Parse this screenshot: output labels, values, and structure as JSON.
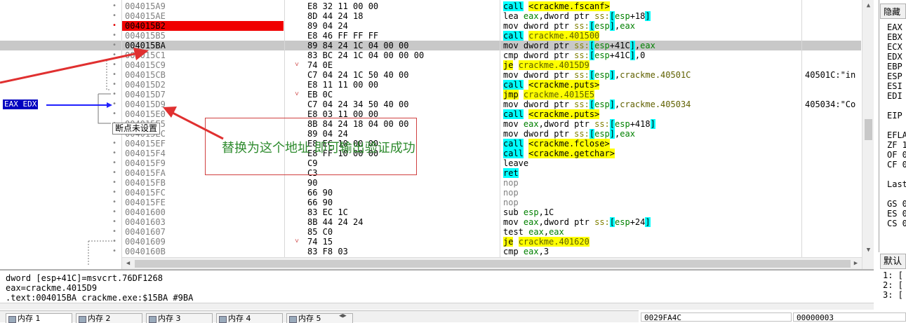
{
  "disasm": {
    "rows": [
      {
        "addr": "004015A9",
        "bytes": "E8 32 11 00 00",
        "instr": "call <crackme.fscanf>",
        "cmt": ""
      },
      {
        "addr": "004015AE",
        "bytes": "8D 44 24 18",
        "instr": "lea eax,dword ptr ss:[esp+18]",
        "cmt": ""
      },
      {
        "addr": "004015B2",
        "bytes": "89 04 24",
        "instr": "mov dword ptr ss:[esp],eax",
        "cmt": ""
      },
      {
        "addr": "004015B5",
        "bytes": "E8 46 FF FF FF",
        "instr": "call crackme.401500",
        "cmt": ""
      },
      {
        "addr": "004015BA",
        "bytes": "89 84 24 1C 04 00 00",
        "instr": "mov dword ptr ss:[esp+41C],eax",
        "cmt": ""
      },
      {
        "addr": "004015C1",
        "bytes": "83 BC 24 1C 04 00 00 00",
        "instr": "cmp dword ptr ss:[esp+41C],0",
        "cmt": ""
      },
      {
        "addr": "004015C9",
        "bytes": "74 0E",
        "instr": "je crackme.4015D9",
        "cmt": ""
      },
      {
        "addr": "004015CB",
        "bytes": "C7 04 24 1C 50 40 00",
        "instr": "mov dword ptr ss:[esp],crackme.40501C",
        "cmt": "40501C:\"in"
      },
      {
        "addr": "004015D2",
        "bytes": "E8 11 11 00 00",
        "instr": "call <crackme.puts>",
        "cmt": ""
      },
      {
        "addr": "004015D7",
        "bytes": "EB 0C",
        "instr": "jmp crackme.4015E5",
        "cmt": ""
      },
      {
        "addr": "004015D9",
        "bytes": "C7 04 24 34 50 40 00",
        "instr": "mov dword ptr ss:[esp],crackme.405034",
        "cmt": "405034:\"Co"
      },
      {
        "addr": "004015E0",
        "bytes": "E8 03 11 00 00",
        "instr": "call <crackme.puts>",
        "cmt": ""
      },
      {
        "addr": "004015E5",
        "bytes": "8B 84 24 18 04 00 00",
        "instr": "mov eax,dword ptr ss:[esp+418]",
        "cmt": ""
      },
      {
        "addr": "004015EC",
        "bytes": "89 04 24",
        "instr": "mov dword ptr ss:[esp],eax",
        "cmt": ""
      },
      {
        "addr": "004015EF",
        "bytes": "E8 EC 10 00 00",
        "instr": "call <crackme.fclose>",
        "cmt": ""
      },
      {
        "addr": "004015F4",
        "bytes": "E8 FF 10 00 00",
        "instr": "call <crackme.getchar>",
        "cmt": ""
      },
      {
        "addr": "004015F9",
        "bytes": "C9",
        "instr": "leave",
        "cmt": ""
      },
      {
        "addr": "004015FA",
        "bytes": "C3",
        "instr": "ret",
        "cmt": ""
      },
      {
        "addr": "004015FB",
        "bytes": "90",
        "instr": "nop",
        "cmt": ""
      },
      {
        "addr": "004015FC",
        "bytes": "66 90",
        "instr": "nop",
        "cmt": ""
      },
      {
        "addr": "004015FE",
        "bytes": "66 90",
        "instr": "nop",
        "cmt": ""
      },
      {
        "addr": "00401600",
        "bytes": "83 EC 1C",
        "instr": "sub esp,1C",
        "cmt": ""
      },
      {
        "addr": "00401603",
        "bytes": "8B 44 24 24",
        "instr": "mov eax,dword ptr ss:[esp+24]",
        "cmt": ""
      },
      {
        "addr": "00401607",
        "bytes": "85 C0",
        "instr": "test eax,eax",
        "cmt": ""
      },
      {
        "addr": "00401609",
        "bytes": "74 15",
        "instr": "je crackme.401620",
        "cmt": ""
      },
      {
        "addr": "0040160B",
        "bytes": "83 F8 03",
        "instr": "cmp eax,3",
        "cmt": ""
      }
    ],
    "eax_edx_tag": "EAX EDX",
    "bp_tooltip": "断点未设置",
    "annotation": "替换为这个地址 即可输出验证成功"
  },
  "info": {
    "line1": "dword [esp+41C]=msvcrt.76DF1268",
    "line2": "eax=crackme.4015D9",
    "line3": ".text:004015BA crackme.exe:$15BA #9BA"
  },
  "regs": {
    "header": "隐藏",
    "lines": [
      "EAX",
      "EBX",
      "ECX",
      "EDX",
      "EBP",
      "ESP",
      "ESI",
      "EDI",
      "",
      "EIP",
      "",
      "EFLA",
      "ZF 1",
      "OF 0",
      "CF 0",
      "",
      "Last",
      "",
      "GS 0",
      "ES 0",
      "CS 0"
    ]
  },
  "stack": {
    "header": "默认",
    "lines": [
      "1: [",
      "2: [",
      "3: ["
    ]
  },
  "tabs": [
    "内存 1",
    "内存 2",
    "内存 3",
    "内存 4",
    "内存 5"
  ],
  "dump": {
    "addr1": "0029FA4C",
    "addr2": "00000003"
  }
}
